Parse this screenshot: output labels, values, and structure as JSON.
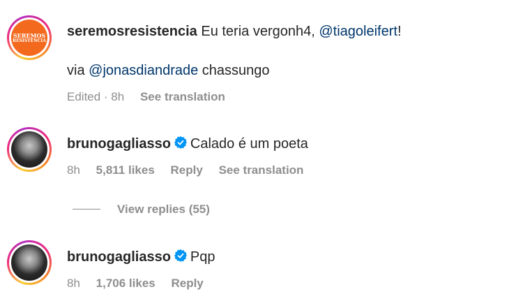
{
  "comments": [
    {
      "username": "seremosresistencia",
      "text_before": "Eu teria vergonh4,",
      "mention": "@tiagoleifert",
      "text_after": "!",
      "line2_prefix": "via",
      "line2_mention": "@jonasdiandrade",
      "line2_suffix": "chassungo",
      "avatar_text": [
        "SEREMOS",
        "RESISTÊNCIA"
      ],
      "edited": "Edited · 8h",
      "see_translation": "See translation"
    },
    {
      "username": "brunogagliasso",
      "verified": true,
      "text": "Calado é um poeta",
      "time": "8h",
      "likes": "5,811 likes",
      "reply": "Reply",
      "see_translation": "See translation",
      "view_replies": "View replies (55)"
    },
    {
      "username": "brunogagliasso",
      "verified": true,
      "text": "Pqp",
      "time": "8h",
      "likes": "1,706 likes",
      "reply": "Reply"
    }
  ],
  "colors": {
    "mention": "#00376b",
    "meta": "#8e8e8e",
    "verified": "#0095f6",
    "org_avatar": "#f36a1f"
  },
  "icons": [
    "verified-badge-icon"
  ]
}
